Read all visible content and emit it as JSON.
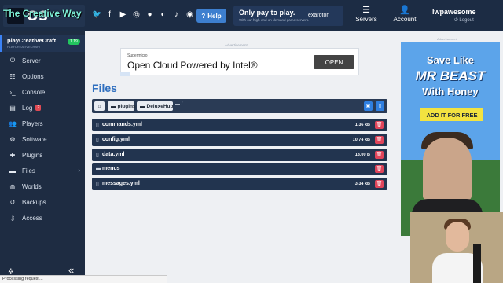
{
  "overlay": {
    "watermark": "The Creative Way"
  },
  "header": {
    "brand": "OS",
    "social_icons": [
      "twitter-icon",
      "facebook-icon",
      "youtube-icon",
      "instagram-icon",
      "reddit-icon",
      "discord-icon",
      "tiktok-icon",
      "github-icon"
    ],
    "help_label": "Help",
    "promo": {
      "title": "Only pay to play.",
      "subtitle": "With our high-end on-demand game servers.",
      "logo": "exaroton"
    },
    "servers_label": "Servers",
    "account_label": "Account",
    "username": "lwpawesome",
    "logout_label": "Logout"
  },
  "sidebar": {
    "server_name": "playCreativeCraft",
    "server_sub": "PLAYCREATIVECRAFT",
    "version": "1.19",
    "items": [
      {
        "label": "Server",
        "icon": "power-icon"
      },
      {
        "label": "Options",
        "icon": "sliders-icon"
      },
      {
        "label": "Console",
        "icon": "terminal-icon"
      },
      {
        "label": "Log",
        "icon": "log-icon",
        "badge": "2"
      },
      {
        "label": "Players",
        "icon": "players-icon"
      },
      {
        "label": "Software",
        "icon": "gear-icon"
      },
      {
        "label": "Plugins",
        "icon": "puzzle-icon"
      },
      {
        "label": "Files",
        "icon": "folder-icon"
      },
      {
        "label": "Worlds",
        "icon": "globe-icon"
      },
      {
        "label": "Backups",
        "icon": "backup-icon"
      },
      {
        "label": "Access",
        "icon": "key-icon"
      }
    ]
  },
  "ad": {
    "label": "Advertisement",
    "brand": "Supermicro",
    "headline": "Open Cloud Powered by Intel®",
    "cta": "OPEN"
  },
  "files": {
    "title": "Files",
    "breadcrumb": [
      "plugins",
      "DeluxeHub"
    ],
    "rows": [
      {
        "name": "commands.yml",
        "size": "1.36 kB",
        "type": "file"
      },
      {
        "name": "config.yml",
        "size": "10.74 kB",
        "type": "file"
      },
      {
        "name": "data.yml",
        "size": "18.00 B",
        "type": "file"
      },
      {
        "name": "menus",
        "size": "",
        "type": "folder"
      },
      {
        "name": "messages.yml",
        "size": "3.34 kB",
        "type": "file"
      }
    ]
  },
  "side_ad": {
    "label": "Advertisement",
    "line1": "Save Like",
    "line2": "MR BEAST",
    "line3": "With Honey",
    "cta": "ADD IT FOR FREE"
  },
  "status_bar": {
    "text": "Processing request..."
  }
}
